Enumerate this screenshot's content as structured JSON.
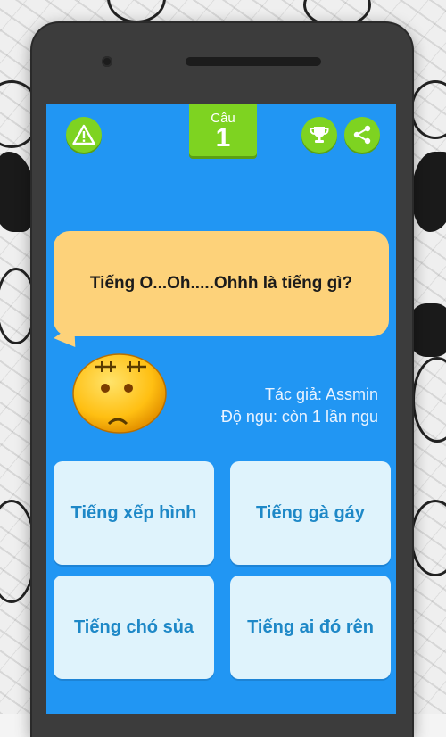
{
  "header": {
    "question_label": "Câu",
    "question_number": "1"
  },
  "icons": {
    "warning": "warning-icon",
    "trophy": "trophy-icon",
    "share": "share-icon"
  },
  "question": {
    "text": "Tiếng O...Oh.....Ohhh là tiếng gì?"
  },
  "info": {
    "author": "Tác giả: Assmin",
    "stupidity": "Độ ngu: còn 1 lần ngu"
  },
  "answers": [
    "Tiếng xếp hình",
    "Tiếng gà gáy",
    "Tiếng chó sủa",
    "Tiếng ai đó rên"
  ],
  "colors": {
    "screen_bg": "#2196f3",
    "accent_green": "#7ed321",
    "bubble": "#fdd27a",
    "answer_bg": "#dff3fc",
    "answer_text": "#1e88c7"
  }
}
